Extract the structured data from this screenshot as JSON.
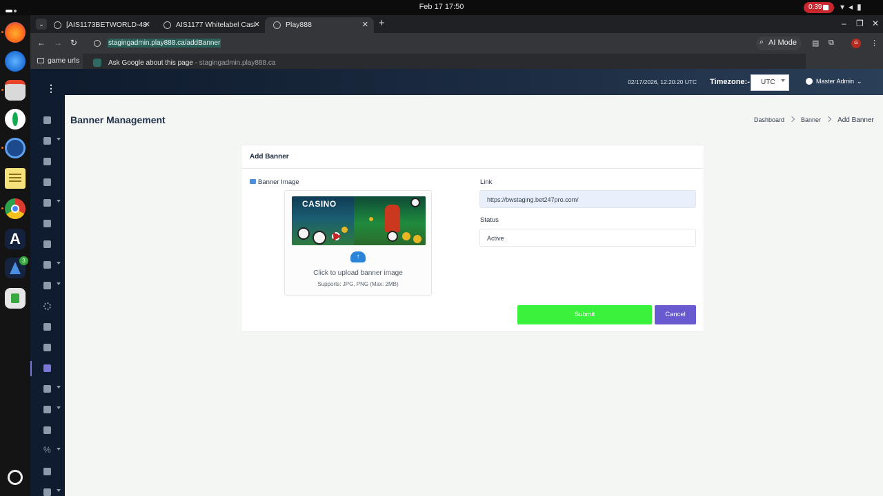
{
  "system": {
    "clock": "Feb 17  17:50",
    "recording": "0:39",
    "indicators": [
      "wifi-icon",
      "volume-icon",
      "battery-icon"
    ]
  },
  "browser": {
    "tabs": [
      {
        "title": "[AIS1173BETWORLD-48",
        "active": false
      },
      {
        "title": "AIS1177 Whitelabel Casi",
        "active": false
      },
      {
        "title": "Play888",
        "active": true
      }
    ],
    "url": "stagingadmin.play888.ca/addBanner",
    "ai_mode_label": "AI Mode",
    "profile_initial": "G",
    "bookmark": "game urls",
    "suggestion": {
      "text": "Ask Google about this page",
      "sub": " - stagingadmin.play888.ca"
    }
  },
  "header": {
    "datetime": "02/17/2026, 12:20:20 UTC",
    "timezone_label": "Timezone:-",
    "timezone_value": "UTC",
    "user": "Master Admin"
  },
  "page": {
    "title": "Banner Management",
    "breadcrumb": [
      "Dashboard",
      "Banner",
      "Add Banner"
    ]
  },
  "form": {
    "card_title": "Add Banner",
    "image_label": "Banner Image",
    "banner_text": "CASINO",
    "upload_text": "Click to upload banner image",
    "upload_hint": "Supports: JPG, PNG (Max: 2MB)",
    "link_label": "Link",
    "link_value": "https://bwstaging.bet247pro.com/",
    "status_label": "Status",
    "status_value": "Active",
    "submit_label": "Submit",
    "cancel_label": "Cancel"
  },
  "colors": {
    "sidebar": "#0f1b2e",
    "submit": "#3af23b",
    "cancel": "#6a5ad0",
    "accent": "#7b77d9"
  },
  "sidebar_icons": [
    "home-icon",
    "user-icon",
    "users-icon",
    "group-icon",
    "mail-icon",
    "list-icon",
    "user-icon",
    "gamepad-icon",
    "puzzle-icon",
    "spinner-icon",
    "gift-icon",
    "trophy-icon",
    "image-icon",
    "megaphone-icon",
    "archive-icon",
    "bank-icon",
    "percent-icon",
    "file-icon",
    "report-icon"
  ]
}
